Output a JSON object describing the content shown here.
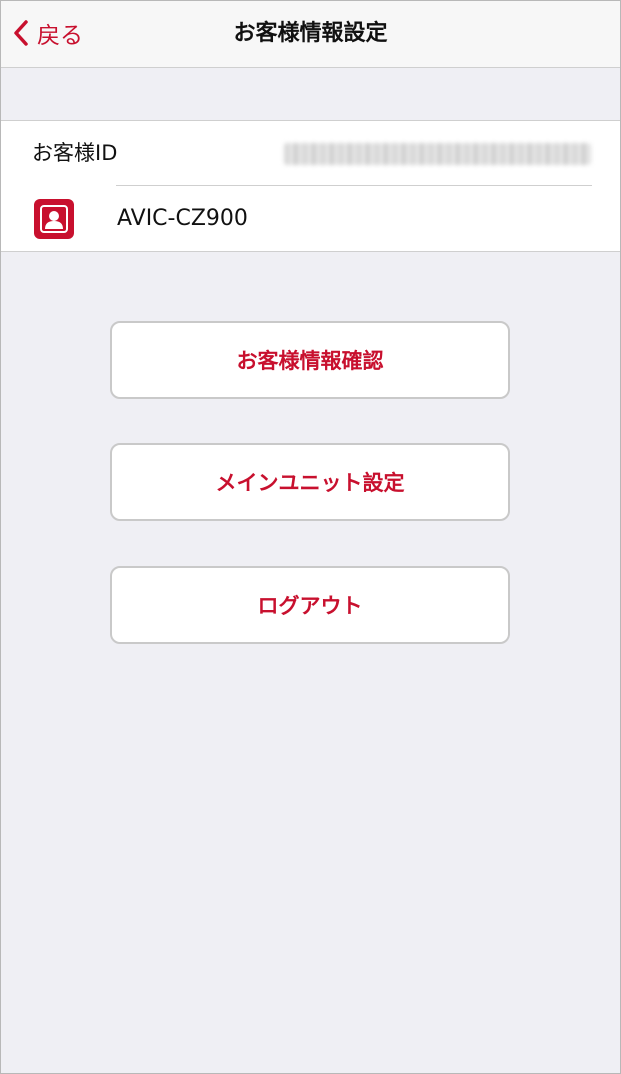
{
  "navbar": {
    "back_label": "戻る",
    "title": "お客様情報設定"
  },
  "account": {
    "id_label": "お客様ID",
    "unit_name": "AVIC-CZ900"
  },
  "buttons": {
    "confirm_info": "お客様情報確認",
    "main_unit_settings": "メインユニット設定",
    "logout": "ログアウト"
  },
  "colors": {
    "accent": "#c8102e",
    "background": "#efeff4",
    "navbar": "#f7f7f7",
    "separator": "#cfcfcf"
  },
  "icons": {
    "back": "chevron-left-icon",
    "unit": "person-icon"
  }
}
